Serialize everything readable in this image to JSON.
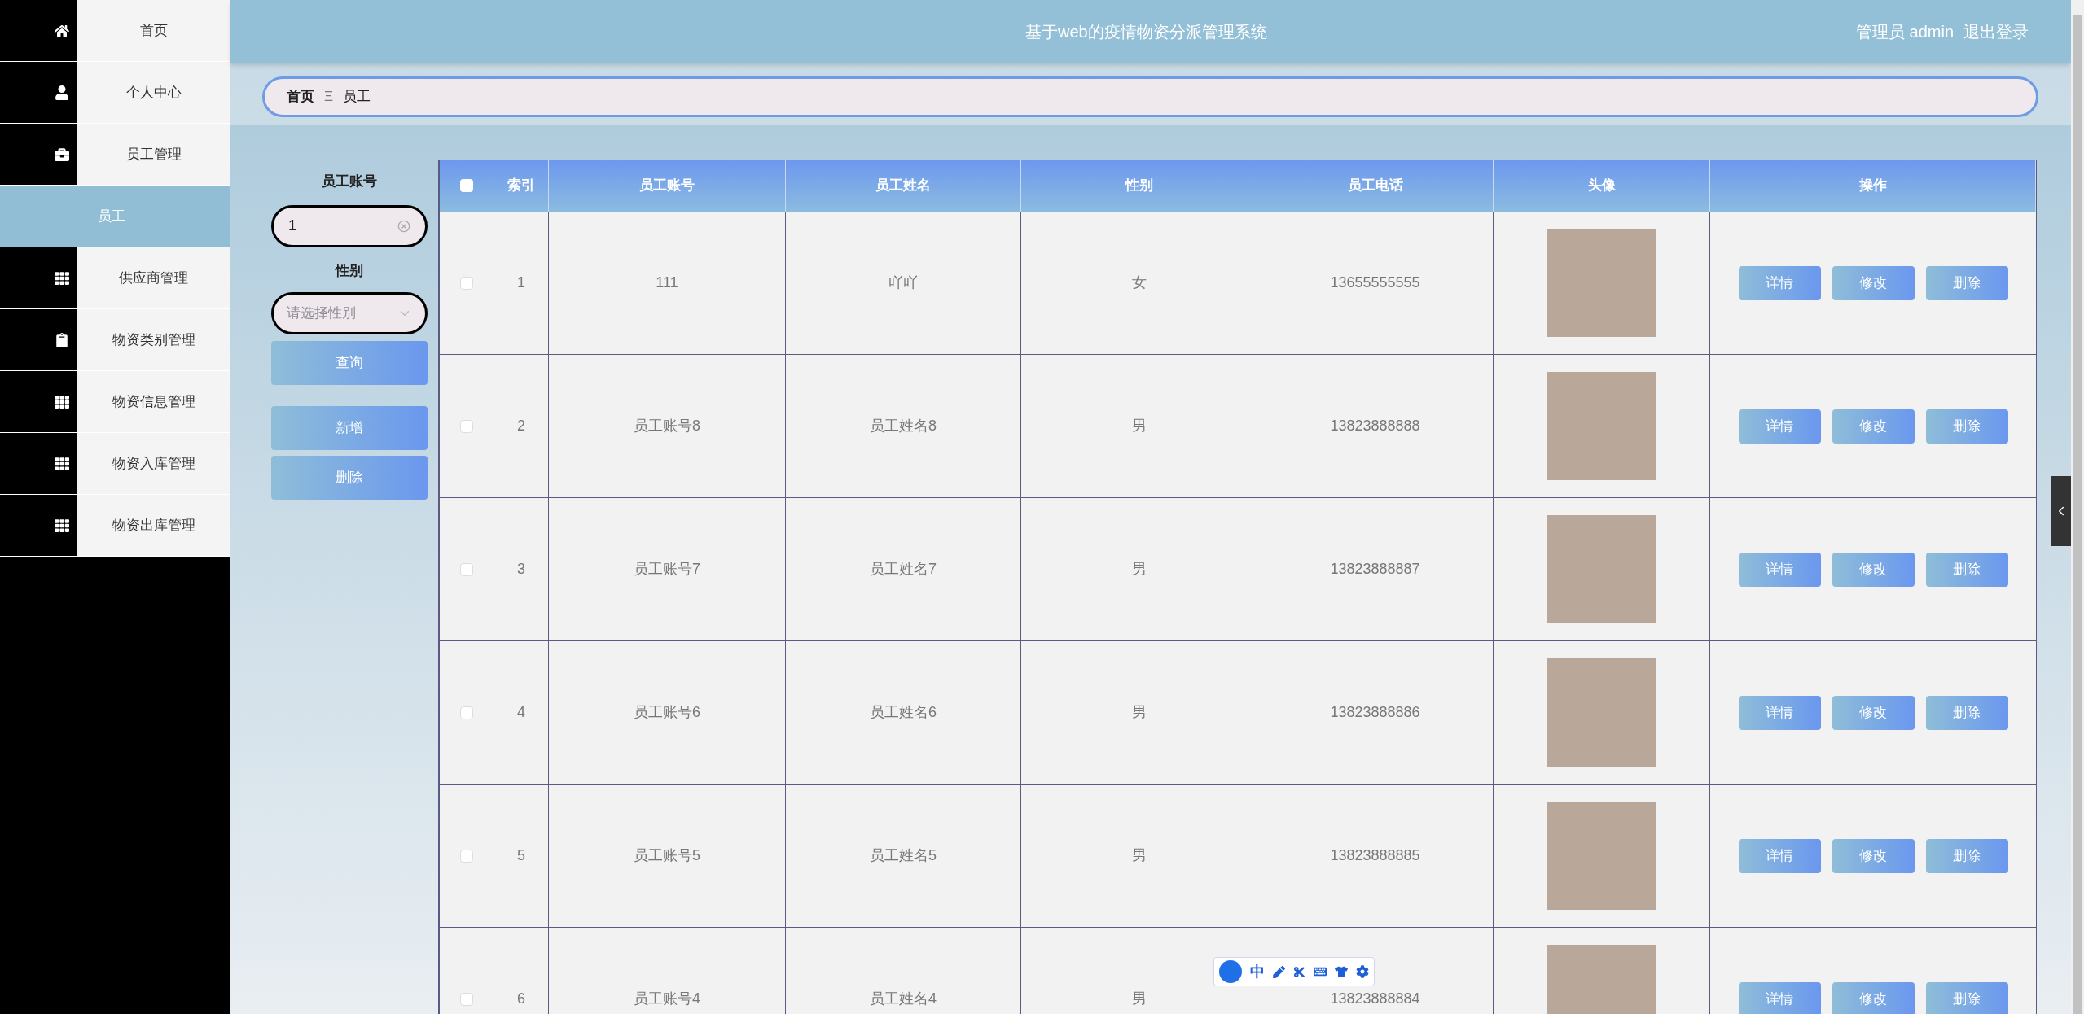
{
  "header": {
    "title": "基于web的疫情物资分派管理系统",
    "user": "管理员 admin",
    "logout": "退出登录"
  },
  "sidebar": {
    "items": [
      {
        "label": "首页",
        "selected": false
      },
      {
        "label": "个人中心",
        "selected": false
      },
      {
        "label": "员工管理",
        "selected": false
      },
      {
        "label": "员工",
        "selected": true
      },
      {
        "label": "供应商管理",
        "selected": false
      },
      {
        "label": "物资类别管理",
        "selected": false
      },
      {
        "label": "物资信息管理",
        "selected": false
      },
      {
        "label": "物资入库管理",
        "selected": false
      },
      {
        "label": "物资出库管理",
        "selected": false
      }
    ]
  },
  "breadcrumb": {
    "home": "首页",
    "separator": "Ξ",
    "current": "员工"
  },
  "search": {
    "account_label": "员工账号",
    "account_value": "1",
    "gender_label": "性别",
    "gender_placeholder": "请选择性别",
    "query": "查询",
    "add": "新增",
    "delete": "删除"
  },
  "table": {
    "select_all_checked": false,
    "columns": [
      "索引",
      "员工账号",
      "员工姓名",
      "性别",
      "员工电话",
      "头像",
      "操作"
    ],
    "rows": [
      {
        "index": "1",
        "account": "111",
        "name": "吖吖",
        "gender": "女",
        "phone": "13655555555",
        "checked": false,
        "actions": [
          "详情",
          "修改",
          "删除"
        ]
      },
      {
        "index": "2",
        "account": "员工账号8",
        "name": "员工姓名8",
        "gender": "男",
        "phone": "13823888888",
        "checked": false,
        "actions": [
          "详情",
          "修改",
          "删除"
        ]
      },
      {
        "index": "3",
        "account": "员工账号7",
        "name": "员工姓名7",
        "gender": "男",
        "phone": "13823888887",
        "checked": false,
        "actions": [
          "详情",
          "修改",
          "删除"
        ]
      },
      {
        "index": "4",
        "account": "员工账号6",
        "name": "员工姓名6",
        "gender": "男",
        "phone": "13823888886",
        "checked": false,
        "actions": [
          "详情",
          "修改",
          "删除"
        ]
      },
      {
        "index": "5",
        "account": "员工账号5",
        "name": "员工姓名5",
        "gender": "男",
        "phone": "13823888885",
        "checked": false,
        "actions": [
          "详情",
          "修改",
          "删除"
        ]
      },
      {
        "index": "6",
        "account": "员工账号4",
        "name": "员工姓名4",
        "gender": "男",
        "phone": "13823888884",
        "checked": false,
        "actions": [
          "详情",
          "修改",
          "删除"
        ]
      }
    ]
  },
  "ime_toolbar": {
    "label": "中"
  }
}
